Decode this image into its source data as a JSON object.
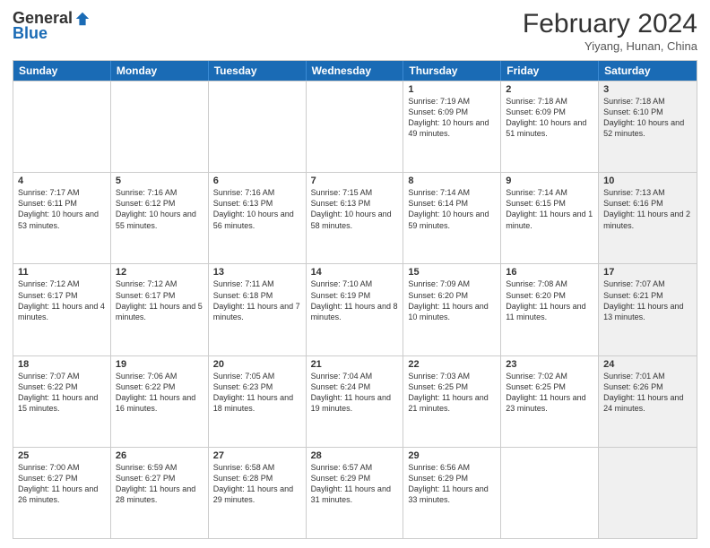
{
  "header": {
    "logo_general": "General",
    "logo_blue": "Blue",
    "month_title": "February 2024",
    "subtitle": "Yiyang, Hunan, China"
  },
  "days_of_week": [
    "Sunday",
    "Monday",
    "Tuesday",
    "Wednesday",
    "Thursday",
    "Friday",
    "Saturday"
  ],
  "weeks": [
    [
      {
        "day": "",
        "info": "",
        "shaded": false
      },
      {
        "day": "",
        "info": "",
        "shaded": false
      },
      {
        "day": "",
        "info": "",
        "shaded": false
      },
      {
        "day": "",
        "info": "",
        "shaded": false
      },
      {
        "day": "1",
        "info": "Sunrise: 7:19 AM\nSunset: 6:09 PM\nDaylight: 10 hours and 49 minutes.",
        "shaded": false
      },
      {
        "day": "2",
        "info": "Sunrise: 7:18 AM\nSunset: 6:09 PM\nDaylight: 10 hours and 51 minutes.",
        "shaded": false
      },
      {
        "day": "3",
        "info": "Sunrise: 7:18 AM\nSunset: 6:10 PM\nDaylight: 10 hours and 52 minutes.",
        "shaded": true
      }
    ],
    [
      {
        "day": "4",
        "info": "Sunrise: 7:17 AM\nSunset: 6:11 PM\nDaylight: 10 hours and 53 minutes.",
        "shaded": false
      },
      {
        "day": "5",
        "info": "Sunrise: 7:16 AM\nSunset: 6:12 PM\nDaylight: 10 hours and 55 minutes.",
        "shaded": false
      },
      {
        "day": "6",
        "info": "Sunrise: 7:16 AM\nSunset: 6:13 PM\nDaylight: 10 hours and 56 minutes.",
        "shaded": false
      },
      {
        "day": "7",
        "info": "Sunrise: 7:15 AM\nSunset: 6:13 PM\nDaylight: 10 hours and 58 minutes.",
        "shaded": false
      },
      {
        "day": "8",
        "info": "Sunrise: 7:14 AM\nSunset: 6:14 PM\nDaylight: 10 hours and 59 minutes.",
        "shaded": false
      },
      {
        "day": "9",
        "info": "Sunrise: 7:14 AM\nSunset: 6:15 PM\nDaylight: 11 hours and 1 minute.",
        "shaded": false
      },
      {
        "day": "10",
        "info": "Sunrise: 7:13 AM\nSunset: 6:16 PM\nDaylight: 11 hours and 2 minutes.",
        "shaded": true
      }
    ],
    [
      {
        "day": "11",
        "info": "Sunrise: 7:12 AM\nSunset: 6:17 PM\nDaylight: 11 hours and 4 minutes.",
        "shaded": false
      },
      {
        "day": "12",
        "info": "Sunrise: 7:12 AM\nSunset: 6:17 PM\nDaylight: 11 hours and 5 minutes.",
        "shaded": false
      },
      {
        "day": "13",
        "info": "Sunrise: 7:11 AM\nSunset: 6:18 PM\nDaylight: 11 hours and 7 minutes.",
        "shaded": false
      },
      {
        "day": "14",
        "info": "Sunrise: 7:10 AM\nSunset: 6:19 PM\nDaylight: 11 hours and 8 minutes.",
        "shaded": false
      },
      {
        "day": "15",
        "info": "Sunrise: 7:09 AM\nSunset: 6:20 PM\nDaylight: 11 hours and 10 minutes.",
        "shaded": false
      },
      {
        "day": "16",
        "info": "Sunrise: 7:08 AM\nSunset: 6:20 PM\nDaylight: 11 hours and 11 minutes.",
        "shaded": false
      },
      {
        "day": "17",
        "info": "Sunrise: 7:07 AM\nSunset: 6:21 PM\nDaylight: 11 hours and 13 minutes.",
        "shaded": true
      }
    ],
    [
      {
        "day": "18",
        "info": "Sunrise: 7:07 AM\nSunset: 6:22 PM\nDaylight: 11 hours and 15 minutes.",
        "shaded": false
      },
      {
        "day": "19",
        "info": "Sunrise: 7:06 AM\nSunset: 6:22 PM\nDaylight: 11 hours and 16 minutes.",
        "shaded": false
      },
      {
        "day": "20",
        "info": "Sunrise: 7:05 AM\nSunset: 6:23 PM\nDaylight: 11 hours and 18 minutes.",
        "shaded": false
      },
      {
        "day": "21",
        "info": "Sunrise: 7:04 AM\nSunset: 6:24 PM\nDaylight: 11 hours and 19 minutes.",
        "shaded": false
      },
      {
        "day": "22",
        "info": "Sunrise: 7:03 AM\nSunset: 6:25 PM\nDaylight: 11 hours and 21 minutes.",
        "shaded": false
      },
      {
        "day": "23",
        "info": "Sunrise: 7:02 AM\nSunset: 6:25 PM\nDaylight: 11 hours and 23 minutes.",
        "shaded": false
      },
      {
        "day": "24",
        "info": "Sunrise: 7:01 AM\nSunset: 6:26 PM\nDaylight: 11 hours and 24 minutes.",
        "shaded": true
      }
    ],
    [
      {
        "day": "25",
        "info": "Sunrise: 7:00 AM\nSunset: 6:27 PM\nDaylight: 11 hours and 26 minutes.",
        "shaded": false
      },
      {
        "day": "26",
        "info": "Sunrise: 6:59 AM\nSunset: 6:27 PM\nDaylight: 11 hours and 28 minutes.",
        "shaded": false
      },
      {
        "day": "27",
        "info": "Sunrise: 6:58 AM\nSunset: 6:28 PM\nDaylight: 11 hours and 29 minutes.",
        "shaded": false
      },
      {
        "day": "28",
        "info": "Sunrise: 6:57 AM\nSunset: 6:29 PM\nDaylight: 11 hours and 31 minutes.",
        "shaded": false
      },
      {
        "day": "29",
        "info": "Sunrise: 6:56 AM\nSunset: 6:29 PM\nDaylight: 11 hours and 33 minutes.",
        "shaded": false
      },
      {
        "day": "",
        "info": "",
        "shaded": false
      },
      {
        "day": "",
        "info": "",
        "shaded": true
      }
    ]
  ]
}
